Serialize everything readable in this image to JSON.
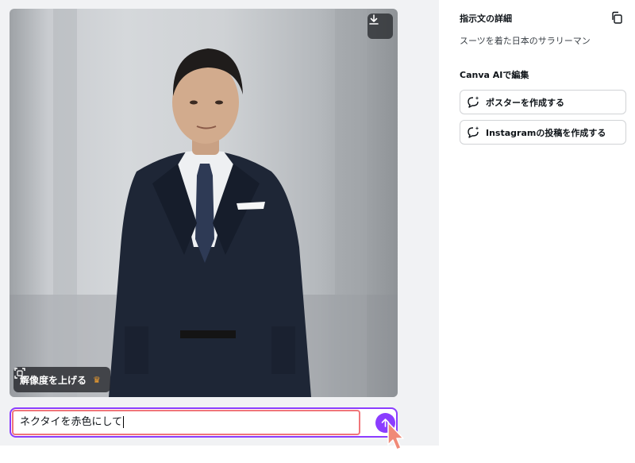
{
  "image": {
    "alt": "",
    "upscale_label": "解像度を上げる",
    "upscale_badge_icon": "crown-icon",
    "download_icon": "download-icon"
  },
  "prompt_bar": {
    "value": "ネクタイを赤色にして",
    "send_icon": "arrow-up-icon"
  },
  "sidebar": {
    "details_title": "指示文の詳細",
    "copy_icon": "copy-icon",
    "prompt_text": "スーツを着た日本のサラリーマン",
    "edit_title": "Canva AIで編集",
    "actions": [
      {
        "label": "ポスターを作成する",
        "icon": "sparkle-chat-icon"
      },
      {
        "label": "Instagramの投稿を作成する",
        "icon": "sparkle-chat-icon"
      }
    ]
  },
  "colors": {
    "accent": "#8b3dff",
    "highlight": "#f0767a",
    "crown": "#f7a22e"
  }
}
